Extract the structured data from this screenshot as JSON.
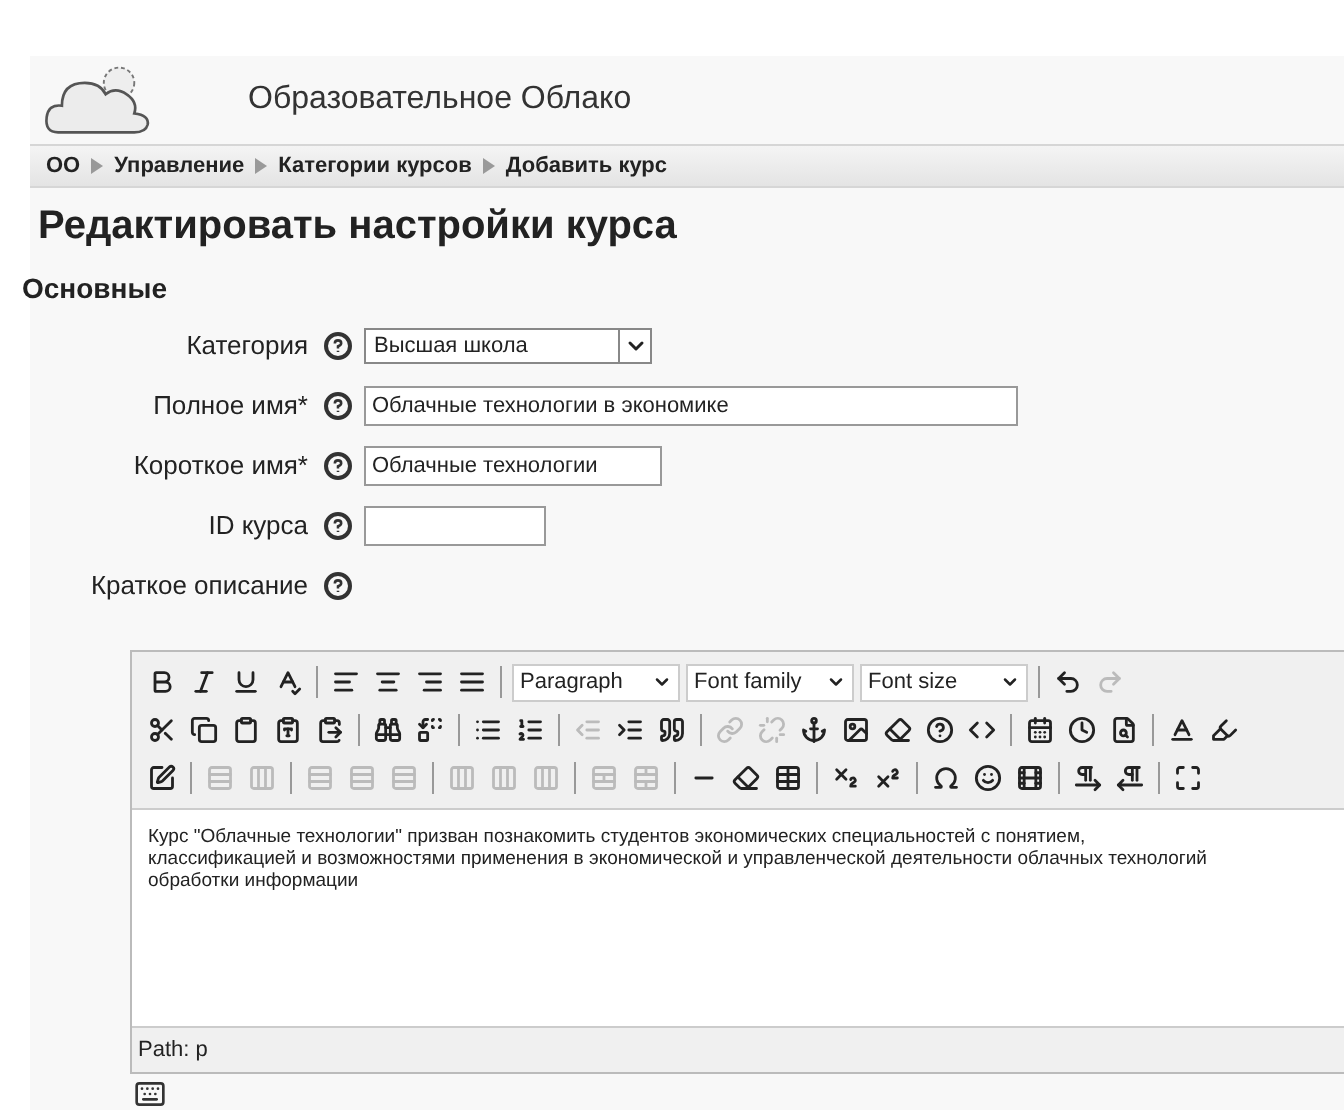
{
  "header": {
    "site_name": "Образовательное Облако"
  },
  "breadcrumb": [
    "ОО",
    "Управление",
    "Категории курсов",
    "Добавить курс"
  ],
  "page_title": "Редактировать настройки курса",
  "section": "Основные",
  "fields": [
    {
      "kind": "select",
      "label": "Категория",
      "value": "Высшая школа"
    },
    {
      "kind": "text",
      "label": "Полное имя*",
      "value": "Облачные технологии в экономике"
    },
    {
      "kind": "text",
      "label": "Короткое имя*",
      "value": "Облачные технологии"
    },
    {
      "kind": "text",
      "label": "ID курса"
    },
    {
      "kind": "editor",
      "label": "Краткое описание"
    }
  ],
  "editor": {
    "toolbar_rows": [
      [
        {
          "kind": "button",
          "disabled": false
        },
        {
          "kind": "button",
          "disabled": false
        },
        {
          "kind": "button",
          "disabled": false
        },
        {
          "kind": "button",
          "disabled": false
        },
        {
          "kind": "separator"
        },
        {
          "kind": "button",
          "disabled": false
        },
        {
          "kind": "button",
          "disabled": false
        },
        {
          "kind": "button",
          "disabled": false
        },
        {
          "kind": "button",
          "disabled": false
        },
        {
          "kind": "separator"
        },
        {
          "kind": "select",
          "label": "Paragraph"
        },
        {
          "kind": "select",
          "label": "Font family"
        },
        {
          "kind": "select",
          "label": "Font size"
        },
        {
          "kind": "separator"
        },
        {
          "kind": "button",
          "disabled": false
        },
        {
          "kind": "button",
          "disabled": true
        }
      ],
      [
        {
          "kind": "button",
          "disabled": false
        },
        {
          "kind": "button",
          "disabled": false
        },
        {
          "kind": "button",
          "disabled": false
        },
        {
          "kind": "button",
          "disabled": false
        },
        {
          "kind": "button",
          "disabled": false
        },
        {
          "kind": "separator"
        },
        {
          "kind": "button",
          "disabled": false
        },
        {
          "kind": "button",
          "disabled": false
        },
        {
          "kind": "separator"
        },
        {
          "kind": "button",
          "disabled": false
        },
        {
          "kind": "button",
          "disabled": false
        },
        {
          "kind": "separator"
        },
        {
          "kind": "button",
          "disabled": true
        },
        {
          "kind": "button",
          "disabled": false
        },
        {
          "kind": "button",
          "disabled": false
        },
        {
          "kind": "separator"
        },
        {
          "kind": "button",
          "disabled": true
        },
        {
          "kind": "button",
          "disabled": true
        },
        {
          "kind": "button",
          "disabled": false
        },
        {
          "kind": "button",
          "disabled": false
        },
        {
          "kind": "button",
          "disabled": false
        },
        {
          "kind": "button",
          "disabled": false
        },
        {
          "kind": "button",
          "disabled": false
        },
        {
          "kind": "separator"
        },
        {
          "kind": "button",
          "disabled": false
        },
        {
          "kind": "button",
          "disabled": false
        },
        {
          "kind": "button",
          "disabled": false
        },
        {
          "kind": "separator"
        },
        {
          "kind": "button",
          "disabled": false
        },
        {
          "kind": "button",
          "disabled": false
        }
      ],
      [
        {
          "kind": "button",
          "disabled": false
        },
        {
          "kind": "separator"
        },
        {
          "kind": "button",
          "disabled": true
        },
        {
          "kind": "button",
          "disabled": true
        },
        {
          "kind": "separator"
        },
        {
          "kind": "button",
          "disabled": true
        },
        {
          "kind": "button",
          "disabled": true
        },
        {
          "kind": "button",
          "disabled": true
        },
        {
          "kind": "separator"
        },
        {
          "kind": "button",
          "disabled": true
        },
        {
          "kind": "button",
          "disabled": true
        },
        {
          "kind": "button",
          "disabled": true
        },
        {
          "kind": "separator"
        },
        {
          "kind": "button",
          "disabled": true
        },
        {
          "kind": "button",
          "disabled": true
        },
        {
          "kind": "separator"
        },
        {
          "kind": "button",
          "disabled": false
        },
        {
          "kind": "button",
          "disabled": false
        },
        {
          "kind": "button",
          "disabled": false
        },
        {
          "kind": "separator"
        },
        {
          "kind": "button",
          "disabled": false
        },
        {
          "kind": "button",
          "disabled": false
        },
        {
          "kind": "separator"
        },
        {
          "kind": "button",
          "disabled": false
        },
        {
          "kind": "button",
          "disabled": false
        },
        {
          "kind": "button",
          "disabled": false
        },
        {
          "kind": "separator"
        },
        {
          "kind": "button",
          "disabled": false
        },
        {
          "kind": "button",
          "disabled": false
        },
        {
          "kind": "separator"
        },
        {
          "kind": "button",
          "disabled": false
        }
      ]
    ],
    "content": "Курс \"Облачные технологии\" призван познакомить студентов экономических специальностей с понятием, классификацией и возможностями применения в экономической и управленческой деятельности облачных технологий обработки информации",
    "path": "Path: p"
  }
}
